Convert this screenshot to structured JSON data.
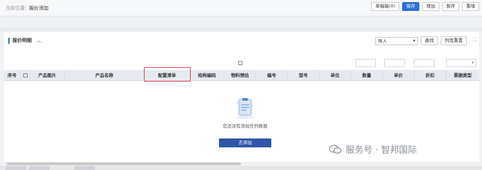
{
  "header": {
    "breadcrumb_prefix": "当前位置:",
    "breadcrumb_current": "报价添加",
    "actions": [
      "草稿箱(0)",
      "保存",
      "增加",
      "暂存",
      "重填"
    ]
  },
  "section": {
    "title": "报价明细",
    "collapse_icon": "chevron-up-icon",
    "import_value": "导入",
    "search_label": "查找",
    "reset_columns_label": "列宽重置",
    "expand_icon": "expand-icon"
  },
  "table": {
    "columns": [
      "序号",
      "",
      "产品图片",
      "产品名称",
      "配置清单",
      "结构编码",
      "物料预估",
      "编号",
      "型号",
      "单位",
      "数量",
      "单价",
      "折扣",
      "票据类型"
    ],
    "highlighted_column": "配置清单",
    "empty_text": "您还没有添加任何数据",
    "add_label": "去添加"
  },
  "watermark": {
    "text": "服务号 · 智邦国际"
  },
  "colors": {
    "primary": "#2f6fd6",
    "add_button": "#2f56a8",
    "highlight": "#e04848",
    "header_bg": "#e6eaf0"
  }
}
